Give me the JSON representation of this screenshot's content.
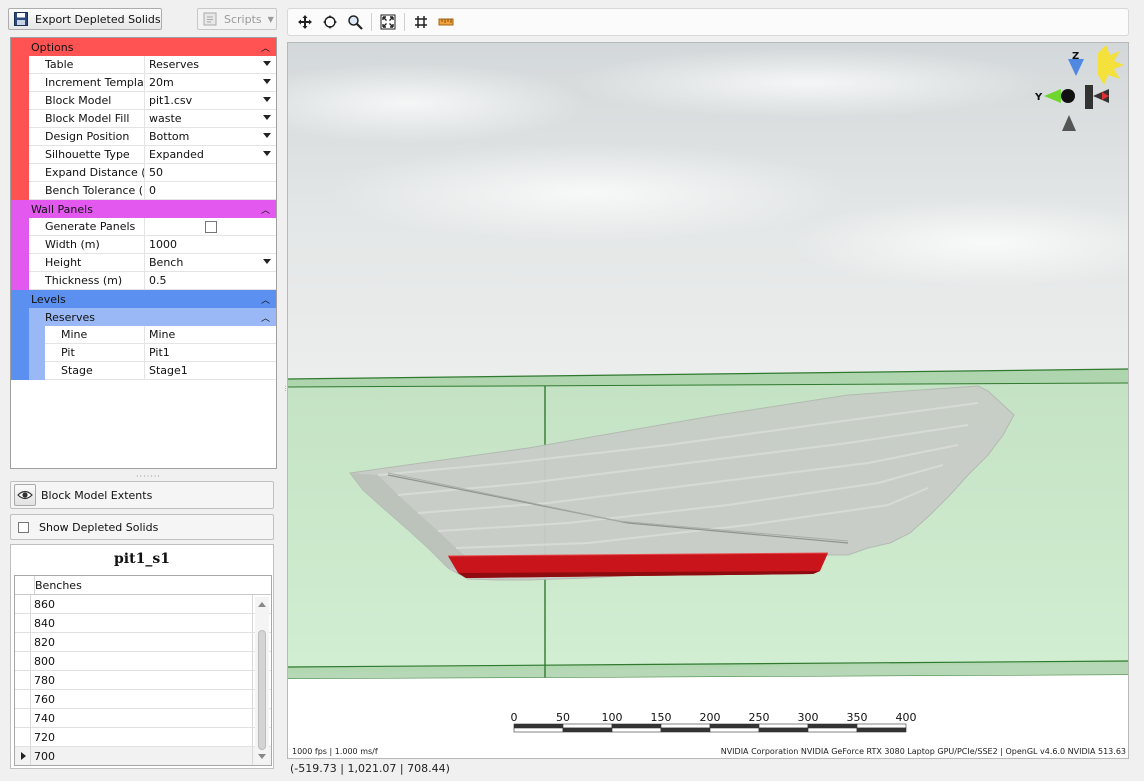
{
  "toolbar_left": {
    "export_label": "Export Depleted Solids",
    "scripts_label": "Scripts"
  },
  "options": {
    "title": "Options",
    "color": "#ff5353",
    "rows": [
      {
        "key": "Table",
        "value": "Reserves",
        "dropdown": true
      },
      {
        "key": "Increment Template",
        "value": "20m",
        "dropdown": true
      },
      {
        "key": "Block Model",
        "value": "pit1.csv",
        "dropdown": true
      },
      {
        "key": "Block Model Fill",
        "value": "waste",
        "dropdown": true
      },
      {
        "key": "Design Position",
        "value": "Bottom",
        "dropdown": true
      },
      {
        "key": "Silhouette Type",
        "value": "Expanded",
        "dropdown": true
      },
      {
        "key": "Expand Distance (...",
        "value": "50",
        "dropdown": false
      },
      {
        "key": "Bench Tolerance (...",
        "value": "0",
        "dropdown": false
      }
    ]
  },
  "wall_panels": {
    "title": "Wall Panels",
    "color": "#e359ef",
    "rows": [
      {
        "key": "Generate Panels",
        "value": "",
        "checkbox": true
      },
      {
        "key": "Width (m)",
        "value": "1000"
      },
      {
        "key": "Height",
        "value": "Bench",
        "dropdown": true
      },
      {
        "key": "Thickness (m)",
        "value": "0.5"
      }
    ]
  },
  "levels": {
    "title": "Levels",
    "color": "#5b8ff0",
    "sub_title": "Reserves",
    "sub_color": "#9ab8f5",
    "rows": [
      {
        "key": "Mine",
        "value": "Mine"
      },
      {
        "key": "Pit",
        "value": "Pit1"
      },
      {
        "key": "Stage",
        "value": "Stage1"
      }
    ]
  },
  "block_model_extents_label": "Block Model Extents",
  "show_depleted_label": "Show Depleted Solids",
  "bench_panel": {
    "title": "pit1_s1",
    "column": "Benches",
    "rows": [
      "860",
      "840",
      "820",
      "800",
      "780",
      "760",
      "740",
      "720",
      "700"
    ],
    "selected": "700"
  },
  "viewport": {
    "scale_labels": [
      "0",
      "50",
      "100",
      "150",
      "200",
      "250",
      "300",
      "350",
      "400"
    ],
    "fps_text": "1000 fps | 1.000 ms/f",
    "gpu_text": "NVIDIA Corporation NVIDIA GeForce RTX 3080 Laptop GPU/PCIe/SSE2 | OpenGL v4.6.0 NVIDIA 513.63",
    "axis_z": "Z",
    "axis_y": "Y"
  },
  "status": {
    "coords": "(-519.73 | 1,021.07 | 708.44)"
  }
}
